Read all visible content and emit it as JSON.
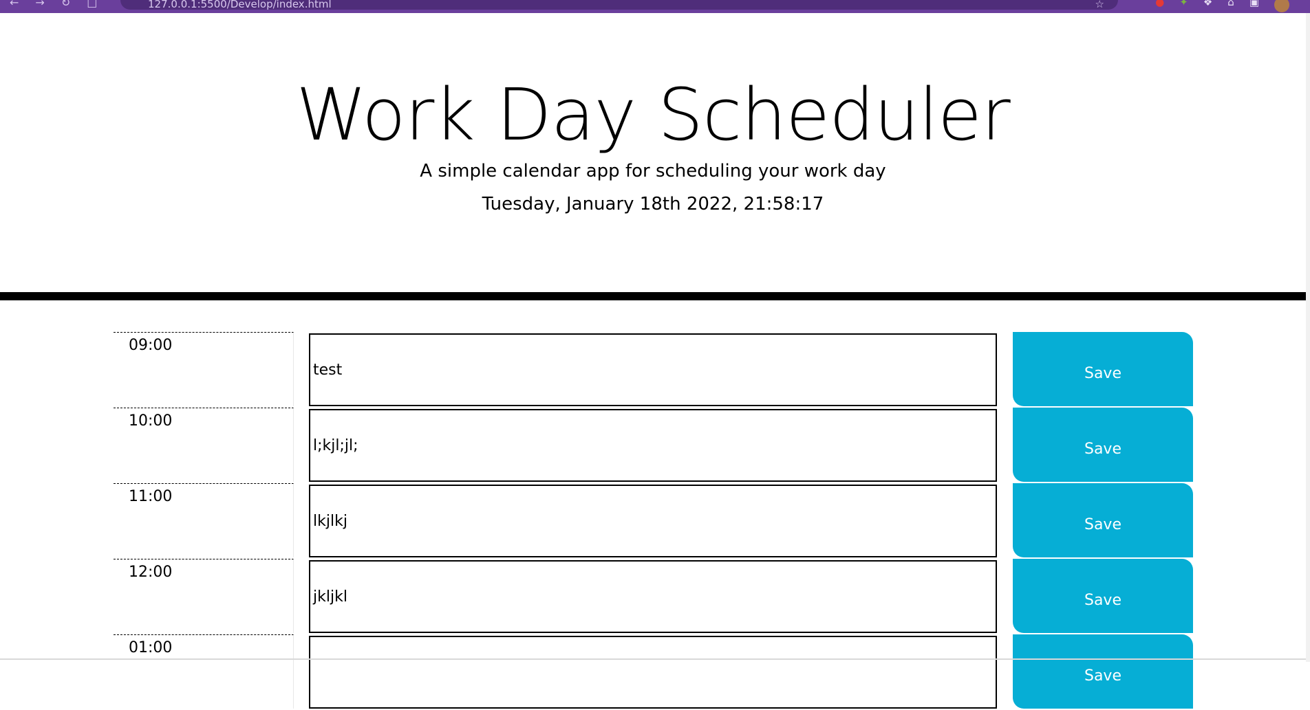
{
  "browser": {
    "address": "127.0.0.1:5500/Develop/index.html"
  },
  "header": {
    "title": "Work Day Scheduler",
    "lead": "A simple calendar app for scheduling your work day",
    "current_day": "Tuesday, January 18th 2022, 21:58:17"
  },
  "colors": {
    "save_button": "#06aed5",
    "browser_bar": "#6a3f9c",
    "header_border": "#000000"
  },
  "rows": [
    {
      "hour": "09:00",
      "text": "test",
      "save_label": "Save"
    },
    {
      "hour": "10:00",
      "text": "l;kjl;jl;",
      "save_label": "Save"
    },
    {
      "hour": "11:00",
      "text": "lkjlkj",
      "save_label": "Save"
    },
    {
      "hour": "12:00",
      "text": "jkljkl",
      "save_label": "Save"
    },
    {
      "hour": "01:00",
      "text": "",
      "save_label": "Save"
    }
  ]
}
